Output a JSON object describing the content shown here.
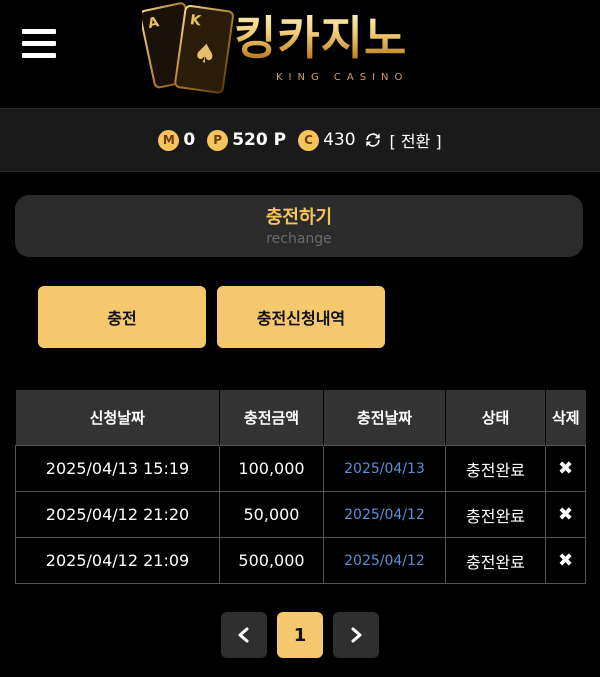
{
  "header": {
    "logo_text": "킹카지노",
    "logo_subtext": "KING CASINO"
  },
  "points": {
    "m_icon": "M",
    "m_value": "0",
    "p_icon": "P",
    "p_value": "520 P",
    "c_icon": "C",
    "c_value": "430",
    "switch_label": "[ 전환 ]"
  },
  "title": {
    "main": "충전하기",
    "sub": "rechange"
  },
  "tabs": [
    {
      "label": "충전"
    },
    {
      "label": "충전신청내역"
    }
  ],
  "table": {
    "headers": [
      "신청날짜",
      "충전금액",
      "충전날짜",
      "상태",
      "삭제"
    ],
    "rows": [
      {
        "request_date": "2025/04/13 15:19",
        "amount": "100,000",
        "charge_date": "2025/04/13",
        "status": "충전완료",
        "delete": "✖"
      },
      {
        "request_date": "2025/04/12 21:20",
        "amount": "50,000",
        "charge_date": "2025/04/12",
        "status": "충전완료",
        "delete": "✖"
      },
      {
        "request_date": "2025/04/12 21:09",
        "amount": "500,000",
        "charge_date": "2025/04/12",
        "status": "충전완료",
        "delete": "✖"
      }
    ]
  },
  "pagination": {
    "prev_icon": "chevron-left-icon",
    "current_page": "1",
    "next_icon": "chevron-right-icon"
  },
  "colors": {
    "accent": "#f6c86e",
    "link": "#5a8fd6",
    "panel": "#2b2b2b"
  }
}
